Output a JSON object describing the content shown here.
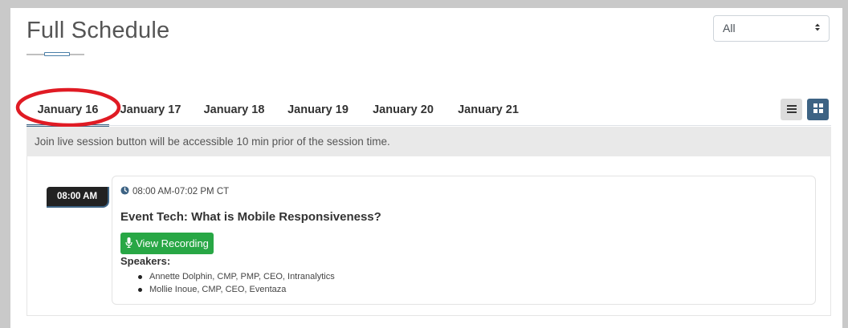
{
  "header": {
    "title": "Full Schedule"
  },
  "filter": {
    "selected": "All"
  },
  "tabs": [
    {
      "label": "January 16",
      "active": true
    },
    {
      "label": "January 17",
      "active": false
    },
    {
      "label": "January 18",
      "active": false
    },
    {
      "label": "January 19",
      "active": false
    },
    {
      "label": "January 20",
      "active": false
    },
    {
      "label": "January 21",
      "active": false
    }
  ],
  "view_toggle": {
    "list_icon": "list-icon",
    "grid_icon": "grid-icon",
    "active": "grid"
  },
  "notice": "Join live session button will be accessible 10 min prior of the session time.",
  "session": {
    "badge_time": "08:00 AM",
    "time_range": "08:00 AM-07:02 PM CT",
    "title": "Event Tech: What is Mobile Responsiveness?",
    "recording_label": "View Recording",
    "speakers_label": "Speakers:",
    "speakers": [
      "Annette Dolphin, CMP, PMP, CEO, Intranalytics",
      "Mollie Inoue, CMP, CEO, Eventaza"
    ]
  },
  "colors": {
    "accent": "#3d6384",
    "recording": "#28a745",
    "annotation": "#e01b24"
  }
}
